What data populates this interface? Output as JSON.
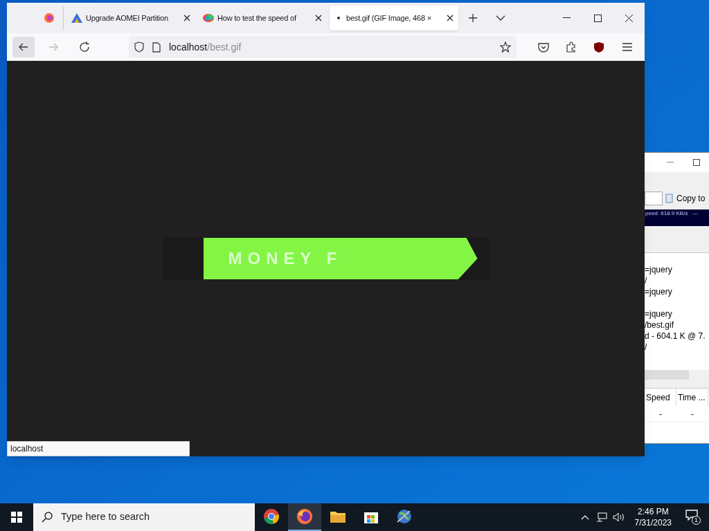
{
  "browser": {
    "tabs": [
      {
        "kind": "pinned",
        "selected": false
      },
      {
        "kind": "normal",
        "label": "Upgrade AOMEI Partition",
        "selected": false
      },
      {
        "kind": "normal",
        "label": "How to test the speed of",
        "selected": false
      },
      {
        "kind": "normal",
        "label": "best.gif (GIF Image, 468 ×",
        "selected": true
      }
    ],
    "address": {
      "host": "localhost",
      "path": "/best.gif"
    },
    "image": {
      "text": "MONEY F"
    },
    "status": "localhost"
  },
  "background_window": {
    "button": "Copy to",
    "speed_line": "peed: 618.9 KB/s   ---",
    "log_groups": [
      [
        "=jquery",
        "/",
        "=jquery"
      ],
      [
        "=jquery",
        "/best.gif",
        "d - 604.1 K @ 7.",
        "/"
      ]
    ],
    "columns": [
      "Speed",
      "Time ..."
    ],
    "rows": [
      [
        "-",
        "-"
      ]
    ]
  },
  "taskbar": {
    "search_placeholder": "Type here to search",
    "apps": [
      {
        "kind": "chrome",
        "active": false
      },
      {
        "kind": "firefox",
        "active": true
      },
      {
        "kind": "folder",
        "active": false
      },
      {
        "kind": "store",
        "active": false
      },
      {
        "kind": "globe",
        "active": false
      }
    ],
    "time": "2:46 PM",
    "date": "7/31/2023",
    "notifications": "1"
  }
}
